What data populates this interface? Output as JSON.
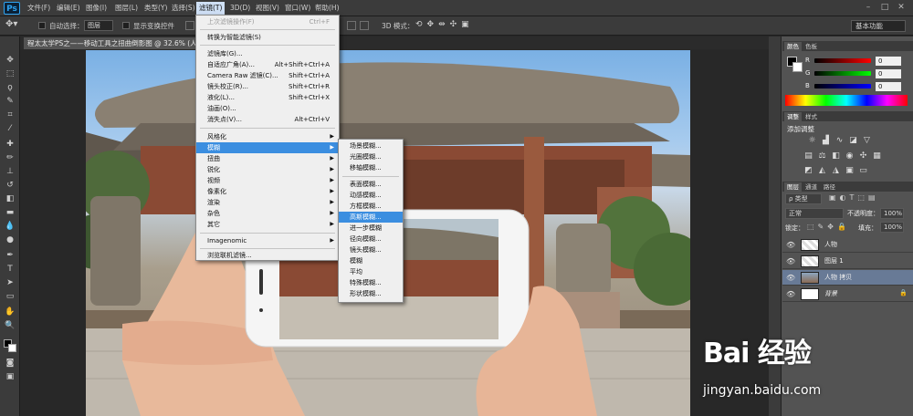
{
  "app": {
    "logo": "Ps"
  },
  "menubar": {
    "items": [
      "文件(F)",
      "编辑(E)",
      "图像(I)",
      "图层(L)",
      "类型(Y)",
      "选择(S)",
      "滤镜(T)",
      "3D(D)",
      "视图(V)",
      "窗口(W)",
      "帮助(H)"
    ],
    "active": "滤镜(T)"
  },
  "options": {
    "auto_select_label": "自动选择：",
    "auto_select_value": "图层",
    "show_transform_label": "显示变换控件",
    "mode_3d_label": "3D 模式：",
    "workspace": "基本功能"
  },
  "document": {
    "tab_title": "程太太学PS之——移动工具之扭曲倒影图 @ 32.6% (人物 ..."
  },
  "filter_menu": {
    "items": [
      {
        "label": "上次滤镜操作(F)",
        "shortcut": "Ctrl+F",
        "disabled": true
      },
      {
        "sep": true
      },
      {
        "label": "转换为智能滤镜(S)"
      },
      {
        "sep": true
      },
      {
        "label": "滤镜库(G)..."
      },
      {
        "label": "自适应广角(A)...",
        "shortcut": "Alt+Shift+Ctrl+A"
      },
      {
        "label": "Camera Raw 滤镜(C)...",
        "shortcut": "Shift+Ctrl+A"
      },
      {
        "label": "镜头校正(R)...",
        "shortcut": "Shift+Ctrl+R"
      },
      {
        "label": "液化(L)...",
        "shortcut": "Shift+Ctrl+X"
      },
      {
        "label": "油画(O)..."
      },
      {
        "label": "消失点(V)...",
        "shortcut": "Alt+Ctrl+V"
      },
      {
        "sep": true
      },
      {
        "label": "风格化",
        "submenu": true
      },
      {
        "label": "模糊",
        "submenu": true,
        "highlight": true
      },
      {
        "label": "扭曲",
        "submenu": true
      },
      {
        "label": "锐化",
        "submenu": true
      },
      {
        "label": "视频",
        "submenu": true
      },
      {
        "label": "像素化",
        "submenu": true
      },
      {
        "label": "渲染",
        "submenu": true
      },
      {
        "label": "杂色",
        "submenu": true
      },
      {
        "label": "其它",
        "submenu": true
      },
      {
        "sep": true
      },
      {
        "label": "Imagenomic",
        "submenu": true
      },
      {
        "sep": true
      },
      {
        "label": "浏览联机滤镜..."
      }
    ]
  },
  "blur_submenu": {
    "items": [
      {
        "label": "场景模糊..."
      },
      {
        "label": "光圈模糊..."
      },
      {
        "label": "移轴模糊..."
      },
      {
        "sep": true
      },
      {
        "label": "表面模糊..."
      },
      {
        "label": "动感模糊..."
      },
      {
        "label": "方框模糊..."
      },
      {
        "label": "高斯模糊...",
        "highlight": true
      },
      {
        "label": "进一步模糊"
      },
      {
        "label": "径向模糊..."
      },
      {
        "label": "镜头模糊..."
      },
      {
        "label": "模糊"
      },
      {
        "label": "平均"
      },
      {
        "label": "特殊模糊..."
      },
      {
        "label": "形状模糊..."
      }
    ]
  },
  "color_panel": {
    "tabs": [
      "颜色",
      "色板"
    ],
    "r": "0",
    "g": "0",
    "b": "0",
    "r_label": "R",
    "g_label": "G",
    "b_label": "B"
  },
  "adjustments_panel": {
    "tabs": [
      "调整",
      "样式"
    ],
    "title": "添加调整"
  },
  "layers_panel": {
    "tabs": [
      "图层",
      "通道",
      "路径"
    ],
    "kind_filter": "ρ 类型",
    "blend_mode": "正常",
    "opacity_label": "不透明度：",
    "opacity": "100%",
    "lock_label": "锁定：",
    "fill_label": "填充：",
    "fill": "100%",
    "layers": [
      {
        "name": "人物",
        "selected": false
      },
      {
        "name": "图层 1",
        "selected": false
      },
      {
        "name": "人物 拷贝",
        "selected": true
      },
      {
        "name": "背景",
        "selected": false,
        "locked": true
      }
    ]
  },
  "watermark": {
    "brand": "Bai 经验",
    "url": "jingyan.baidu.com"
  },
  "colors": {
    "menu_highlight": "#3b8ee0",
    "panel_bg": "#535353",
    "app_bg": "#282828"
  }
}
